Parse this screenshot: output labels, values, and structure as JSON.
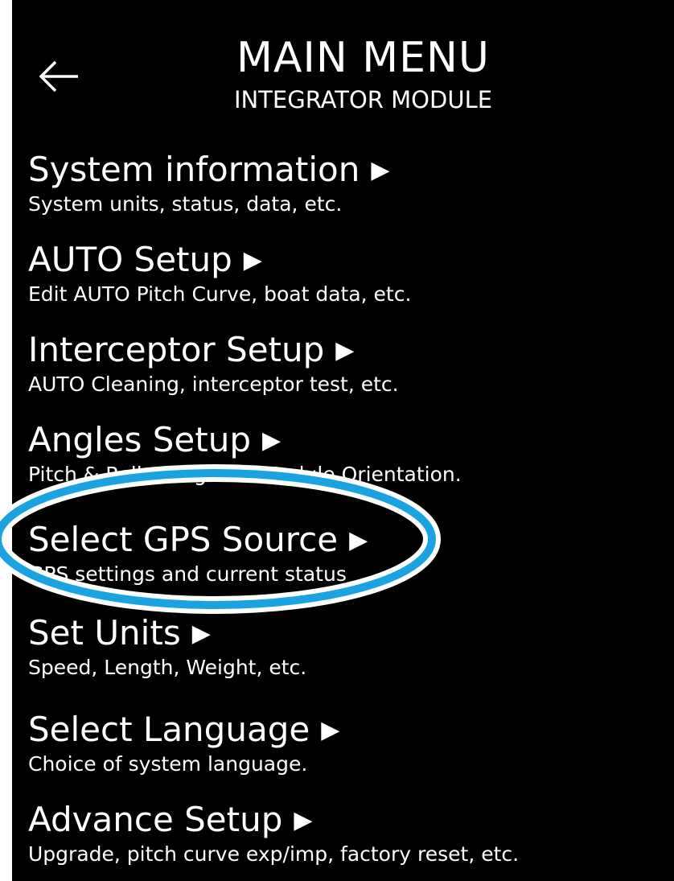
{
  "header": {
    "back_icon": "left-arrow-icon",
    "title": "MAIN MENU",
    "subtitle": "INTEGRATOR MODULE"
  },
  "menu": {
    "items": [
      {
        "label": "System information",
        "description": "System units, status, data, etc."
      },
      {
        "label": "AUTO Setup",
        "description": "Edit AUTO Pitch Curve, boat data, etc."
      },
      {
        "label": "Interceptor Setup",
        "description": "AUTO Cleaning, interceptor test, etc."
      },
      {
        "label": "Angles Setup",
        "description": "Pitch & Roll, Integrator Module Orientation."
      },
      {
        "label": "Select GPS Source",
        "description": "GPS settings and current status"
      },
      {
        "label": "Set Units",
        "description": "Speed, Length, Weight, etc."
      },
      {
        "label": "Select Language",
        "description": "Choice of system language."
      },
      {
        "label": "Advance Setup",
        "description": "Upgrade, pitch curve exp/imp, factory reset, etc."
      }
    ],
    "arrow_icon": "right-triangle-icon"
  },
  "annotation": {
    "highlight_color": "#1aa3e0",
    "highlighted_item": "Select GPS Source"
  },
  "colors": {
    "background": "#000000",
    "text": "#ffffff"
  }
}
